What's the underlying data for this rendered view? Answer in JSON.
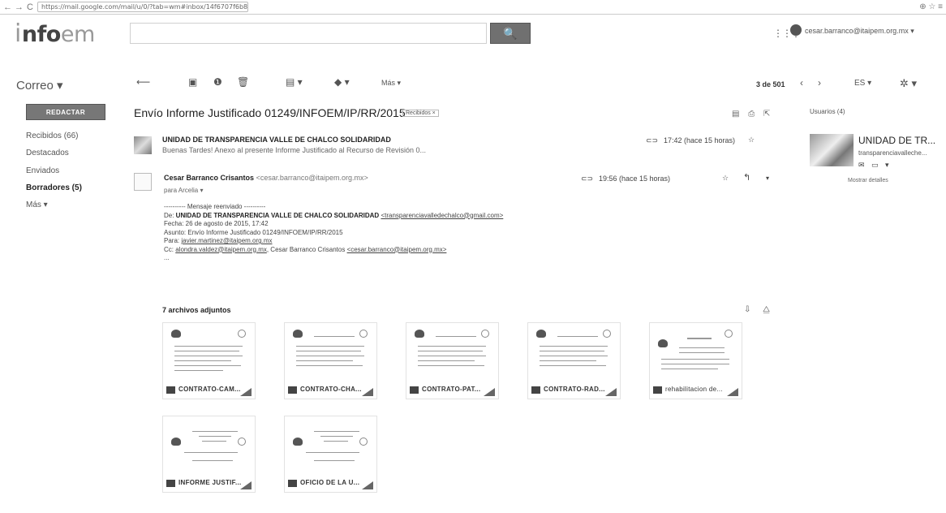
{
  "browser": {
    "url": "https://mail.google.com/mail/u/0/?tab=wm#inbox/14f6707f6b8e3c79",
    "back": "←",
    "forward": "→",
    "reload": "C",
    "right_icons": "⊕ ☆ ≡"
  },
  "header": {
    "logo_lead": "i",
    "logo_main": "nfo",
    "logo_tail": "em",
    "search_icon": "🔍",
    "apps_icon": "⋮⋮⋮",
    "account_email": "cesar.barranco@itaipem.org.mx ▾"
  },
  "toolbar": {
    "app_label": "Correo ▾",
    "back_icon": "⟵",
    "archive_icon": "▣",
    "spam_icon": "❶",
    "delete_icon": "🗑",
    "folder_icon": "▤ ▾",
    "label_icon": "◆ ▾",
    "more_label": "Más ▾",
    "page_count": "3 de 501",
    "prev": "‹",
    "next": "›",
    "lang": "ES ▾",
    "settings": "✲ ▾"
  },
  "sidebar": {
    "compose_label": "REDACTAR",
    "items": [
      {
        "label": "Recibidos (66)",
        "bold": false
      },
      {
        "label": "Destacados",
        "bold": false
      },
      {
        "label": "Enviados",
        "bold": false
      },
      {
        "label": "Borradores (5)",
        "bold": true
      },
      {
        "label": "Más ▾",
        "bold": false
      }
    ]
  },
  "thread": {
    "subject": "Envío Informe Justificado 01249/INFOEM/IP/RR/2015",
    "label": "Recibidos ×",
    "actions": "▤ ⎙ ⇱"
  },
  "messages": [
    {
      "sender": "UNIDAD DE TRANSPARENCIA VALLE DE CHALCO SOLIDARIDAD",
      "snippet": "Buenas Tardes! Anexo al presente Informe Justificado al Recurso de Revisión 0...",
      "attach_icon": "⊂⊃",
      "time": "17:42 (hace 15 horas)",
      "star": "☆"
    },
    {
      "sender": "Cesar Barranco Crisantos",
      "email": "<cesar.barranco@itaipem.org.mx>",
      "recipients": "para Arcelia ▾",
      "attach_icon": "⊂⊃",
      "time": "19:56 (hace 15 horas)",
      "star": "☆",
      "reply": "↰",
      "more": "▾"
    }
  ],
  "forwarded": {
    "divider": "---------- Mensaje reenviado ----------",
    "de_prefix": "De: ",
    "de_name": "UNIDAD DE TRANSPARENCIA VALLE DE CHALCO SOLIDARIDAD",
    "de_email": "<transparenciavalledechalco@gmail.com>",
    "fecha": "Fecha: 26 de agosto de 2015, 17:42",
    "asunto": "Asunto: Envío Informe Justificado 01249/INFOEM/IP/RR/2015",
    "para_prefix": "Para: ",
    "para_email": "javier.martinez@itaipem.org.mx",
    "cc_prefix": "Cc: ",
    "cc_email1": "alondra.valdez@itaipem.org.mx",
    "cc_sep": ", Cesar Barranco Crisantos ",
    "cc_email2": "<cesar.barranco@itaipem.org.mx>",
    "ellipsis": "..."
  },
  "attachments": {
    "title": "7 archivos adjuntos",
    "actions": "⇩ ⧋",
    "files": [
      {
        "name": "CONTRATO-CAM..."
      },
      {
        "name": "CONTRATO-CHA..."
      },
      {
        "name": "CONTRATO-PAT..."
      },
      {
        "name": "CONTRATO-RAD..."
      },
      {
        "name": "rehabilitacion de..."
      },
      {
        "name": "INFORME JUSTIF..."
      },
      {
        "name": "OFICIO DE LA U..."
      }
    ]
  },
  "people": {
    "title": "Usuarios (4)",
    "name": "UNIDAD DE TR...",
    "email": "transparenciavalleche...",
    "actions": "✉ ▭ ▾",
    "more_details": "Mostrar detalles"
  }
}
